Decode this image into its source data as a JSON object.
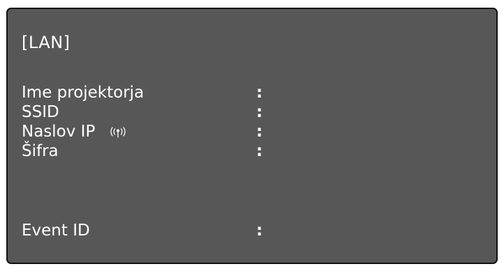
{
  "panel": {
    "title": "[LAN]",
    "separator": ":",
    "rows": [
      {
        "label": "Ime projektorja",
        "value": ""
      },
      {
        "label": "SSID",
        "value": ""
      },
      {
        "label": "Naslov IP",
        "icon": "wireless-signal-icon",
        "value": ""
      },
      {
        "label": "Šifra",
        "value": ""
      },
      {
        "label": "Event ID",
        "value": ""
      }
    ]
  },
  "colors": {
    "background": "#575757",
    "text": "#ffffff",
    "border": "#111111"
  }
}
